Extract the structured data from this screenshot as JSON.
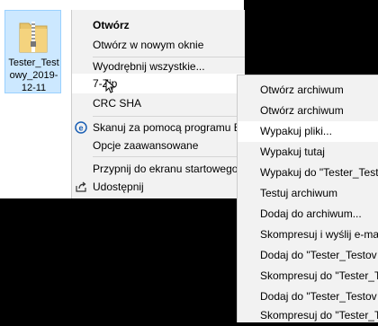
{
  "file": {
    "name_lines": [
      "Tester_Test",
      "owy_2019-",
      "12-11"
    ],
    "icon": "zip-folder-icon"
  },
  "context_menu": {
    "items": [
      {
        "label": "Otwórz",
        "bold": true
      },
      {
        "label": "Otwórz w nowym oknie"
      },
      {
        "label": "Wyodrębnij wszystkie..."
      },
      {
        "label": "7-Zip",
        "highlighted": true
      },
      {
        "label": "CRC SHA"
      },
      {
        "label": "Skanuj za pomocą programu ESET",
        "icon": "eset-icon"
      },
      {
        "label": "Opcje zaawansowane"
      },
      {
        "label": "Przypnij do ekranu startowego"
      },
      {
        "label": "Udostępnij",
        "icon": "share-icon"
      }
    ]
  },
  "submenu_7zip": {
    "items": [
      {
        "label": "Otwórz archiwum"
      },
      {
        "label": "Otwórz archiwum"
      },
      {
        "label": "Wypakuj pliki...",
        "highlighted": true
      },
      {
        "label": "Wypakuj tutaj"
      },
      {
        "label": "Wypakuj do \"Tester_Test"
      },
      {
        "label": "Testuj archiwum"
      },
      {
        "label": "Dodaj do archiwum..."
      },
      {
        "label": "Skompresuj i wyślij e-ma"
      },
      {
        "label": "Dodaj do \"Tester_Testov"
      },
      {
        "label": "Skompresuj do \"Tester_T"
      },
      {
        "label": "Dodaj do \"Tester_Testov"
      },
      {
        "label": "Skompresuj do \"Tester_T"
      }
    ]
  },
  "colors": {
    "selection": "#cce8ff",
    "menu_bg": "#f2f2f2",
    "menu_highlight": "#ffffff",
    "eset_accent": "#1a5fb4"
  }
}
